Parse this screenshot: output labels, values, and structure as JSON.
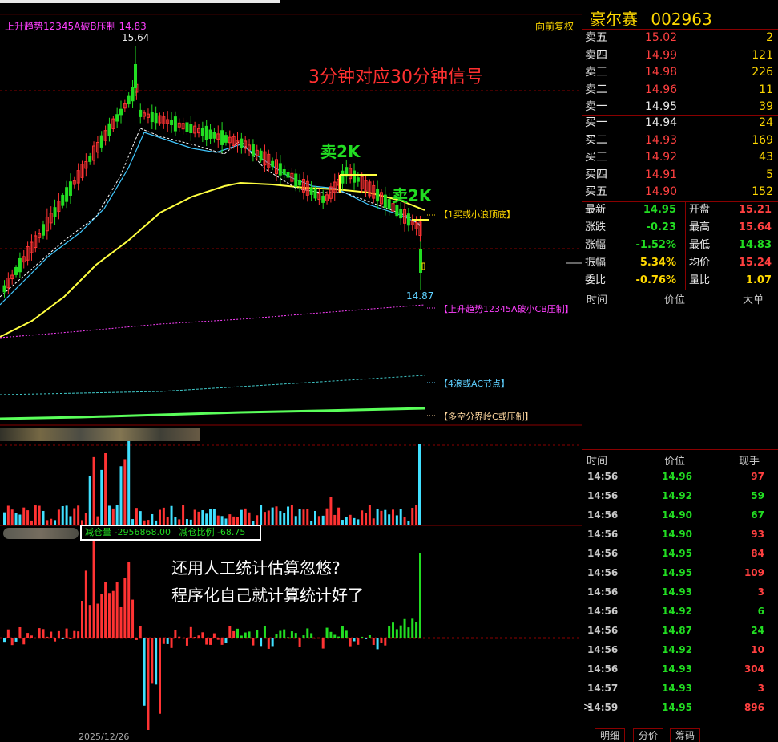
{
  "chart_header": {
    "indicator_label": "上升趋势12345A破B压制",
    "indicator_value": "14.83",
    "restore_label": "向前复权"
  },
  "stock": {
    "name": "豪尔赛",
    "code": "002963"
  },
  "annotations": {
    "headline": "3分钟对应30分钟信号",
    "sell_1": "卖2K",
    "sell_2": "卖2K",
    "high_label": "15.64",
    "low_label": "14.87",
    "tag_top": "【1买或小浪顶底】",
    "tag_cb": "【上升趋势12345A破小CB压制】",
    "tag_4": "【4浪或AC节点】",
    "tag_c": "【多空分界岭C或压制】",
    "promo_line1": "还用人工统计估算忽悠?",
    "promo_line2": "程序化自己就计算统计好了",
    "date_label": "2025/12/26"
  },
  "indicator2": {
    "label1": "减仓量",
    "value1": "-2956868.00",
    "label2": "减仓比例",
    "value2": "-68.75"
  },
  "order_book": {
    "asks": [
      {
        "label": "卖五",
        "price": "15.02",
        "volume": "2"
      },
      {
        "label": "卖四",
        "price": "14.99",
        "volume": "121"
      },
      {
        "label": "卖三",
        "price": "14.98",
        "volume": "226"
      },
      {
        "label": "卖二",
        "price": "14.96",
        "volume": "11"
      },
      {
        "label": "卖一",
        "price": "14.95",
        "volume": "39"
      }
    ],
    "bids": [
      {
        "label": "买一",
        "price": "14.94",
        "volume": "24"
      },
      {
        "label": "买二",
        "price": "14.93",
        "volume": "169"
      },
      {
        "label": "买三",
        "price": "14.92",
        "volume": "43"
      },
      {
        "label": "买四",
        "price": "14.91",
        "volume": "5"
      },
      {
        "label": "买五",
        "price": "14.90",
        "volume": "152"
      }
    ]
  },
  "quote": [
    {
      "l1": "最新",
      "v1": "14.95",
      "c1": "#22dd22",
      "l2": "开盘",
      "v2": "15.21",
      "c2": "#ff4040"
    },
    {
      "l1": "涨跌",
      "v1": "-0.23",
      "c1": "#22dd22",
      "l2": "最高",
      "v2": "15.64",
      "c2": "#ff4040"
    },
    {
      "l1": "涨幅",
      "v1": "-1.52%",
      "c1": "#22dd22",
      "l2": "最低",
      "v2": "14.83",
      "c2": "#22dd22"
    },
    {
      "l1": "振幅",
      "v1": "5.34%",
      "c1": "#ffd800",
      "l2": "均价",
      "v2": "15.24",
      "c2": "#ff4040"
    },
    {
      "l1": "委比",
      "v1": "-0.76%",
      "c1": "#ffd800",
      "l2": "量比",
      "v2": "1.07",
      "c2": "#ffd800"
    }
  ],
  "big_orders_header": {
    "time": "时间",
    "price": "价位",
    "big": "大单"
  },
  "ticks_header": {
    "time": "时间",
    "price": "价位",
    "volume": "现手"
  },
  "ticks": [
    {
      "time": "14:56",
      "price": "14.96",
      "volume": "97",
      "vc": "#ff4040"
    },
    {
      "time": "14:56",
      "price": "14.92",
      "volume": "59",
      "vc": "#22dd22"
    },
    {
      "time": "14:56",
      "price": "14.90",
      "volume": "67",
      "vc": "#22dd22"
    },
    {
      "time": "14:56",
      "price": "14.90",
      "volume": "93",
      "vc": "#ff4040"
    },
    {
      "time": "14:56",
      "price": "14.95",
      "volume": "84",
      "vc": "#ff4040"
    },
    {
      "time": "14:56",
      "price": "14.95",
      "volume": "109",
      "vc": "#ff4040"
    },
    {
      "time": "14:56",
      "price": "14.93",
      "volume": "3",
      "vc": "#ff4040"
    },
    {
      "time": "14:56",
      "price": "14.92",
      "volume": "6",
      "vc": "#22dd22"
    },
    {
      "time": "14:56",
      "price": "14.87",
      "volume": "24",
      "vc": "#22dd22"
    },
    {
      "time": "14:56",
      "price": "14.92",
      "volume": "10",
      "vc": "#ff4040"
    },
    {
      "time": "14:56",
      "price": "14.93",
      "volume": "304",
      "vc": "#ff4040"
    },
    {
      "time": "14:57",
      "price": "14.93",
      "volume": "3",
      "vc": "#ff4040"
    },
    {
      "time": "14:59",
      "price": "14.95",
      "volume": "896",
      "vc": "#ff4040"
    }
  ],
  "tabs": [
    "明细",
    "分价",
    "筹码"
  ],
  "colors": {
    "up": "#ff3333",
    "down": "#22dd22",
    "grid": "#8a0000",
    "accent": "#ffd800"
  }
}
